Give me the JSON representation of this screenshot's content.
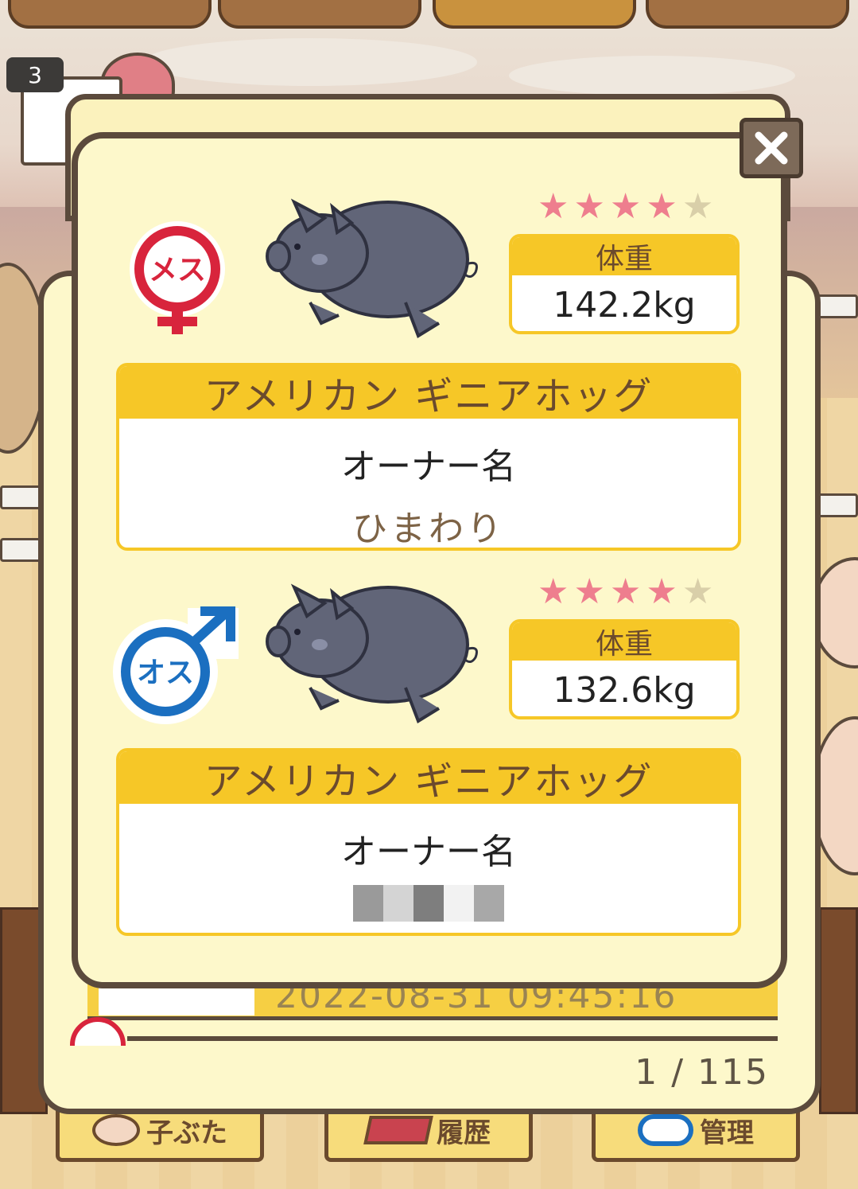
{
  "header": {
    "badge_count": "3"
  },
  "pairs": [
    {
      "gender_label": "メス",
      "stars": {
        "filled": 4,
        "total": 5
      },
      "weight_label": "体重",
      "weight_value": "142.2kg",
      "breed": "アメリカン ギニアホッグ",
      "owner_label": "オーナー名",
      "owner_name": "ひまわり"
    },
    {
      "gender_label": "オス",
      "stars": {
        "filled": 4,
        "total": 5
      },
      "weight_label": "体重",
      "weight_value": "132.6kg",
      "breed": "アメリカン ギニアホッグ",
      "owner_label": "オーナー名",
      "owner_name": ""
    }
  ],
  "background_list": {
    "row_date": "2022-08-31 09:45:16",
    "pager": "1 / 115"
  },
  "bottom_nav": {
    "items": [
      {
        "label": "子ぶた",
        "icon": "pig-face-icon"
      },
      {
        "label": "履歴",
        "icon": "books-icon"
      },
      {
        "label": "管理",
        "icon": "key-icon"
      }
    ]
  },
  "colors": {
    "panel_bg": "#fdf8cb",
    "border": "#5b4a3c",
    "accent_yellow": "#f6c727",
    "female_red": "#d8243c",
    "male_blue": "#1b6fc0",
    "star_on": "#ee7e8e",
    "star_off": "#d9cfa9",
    "pig_body": "#616578"
  }
}
